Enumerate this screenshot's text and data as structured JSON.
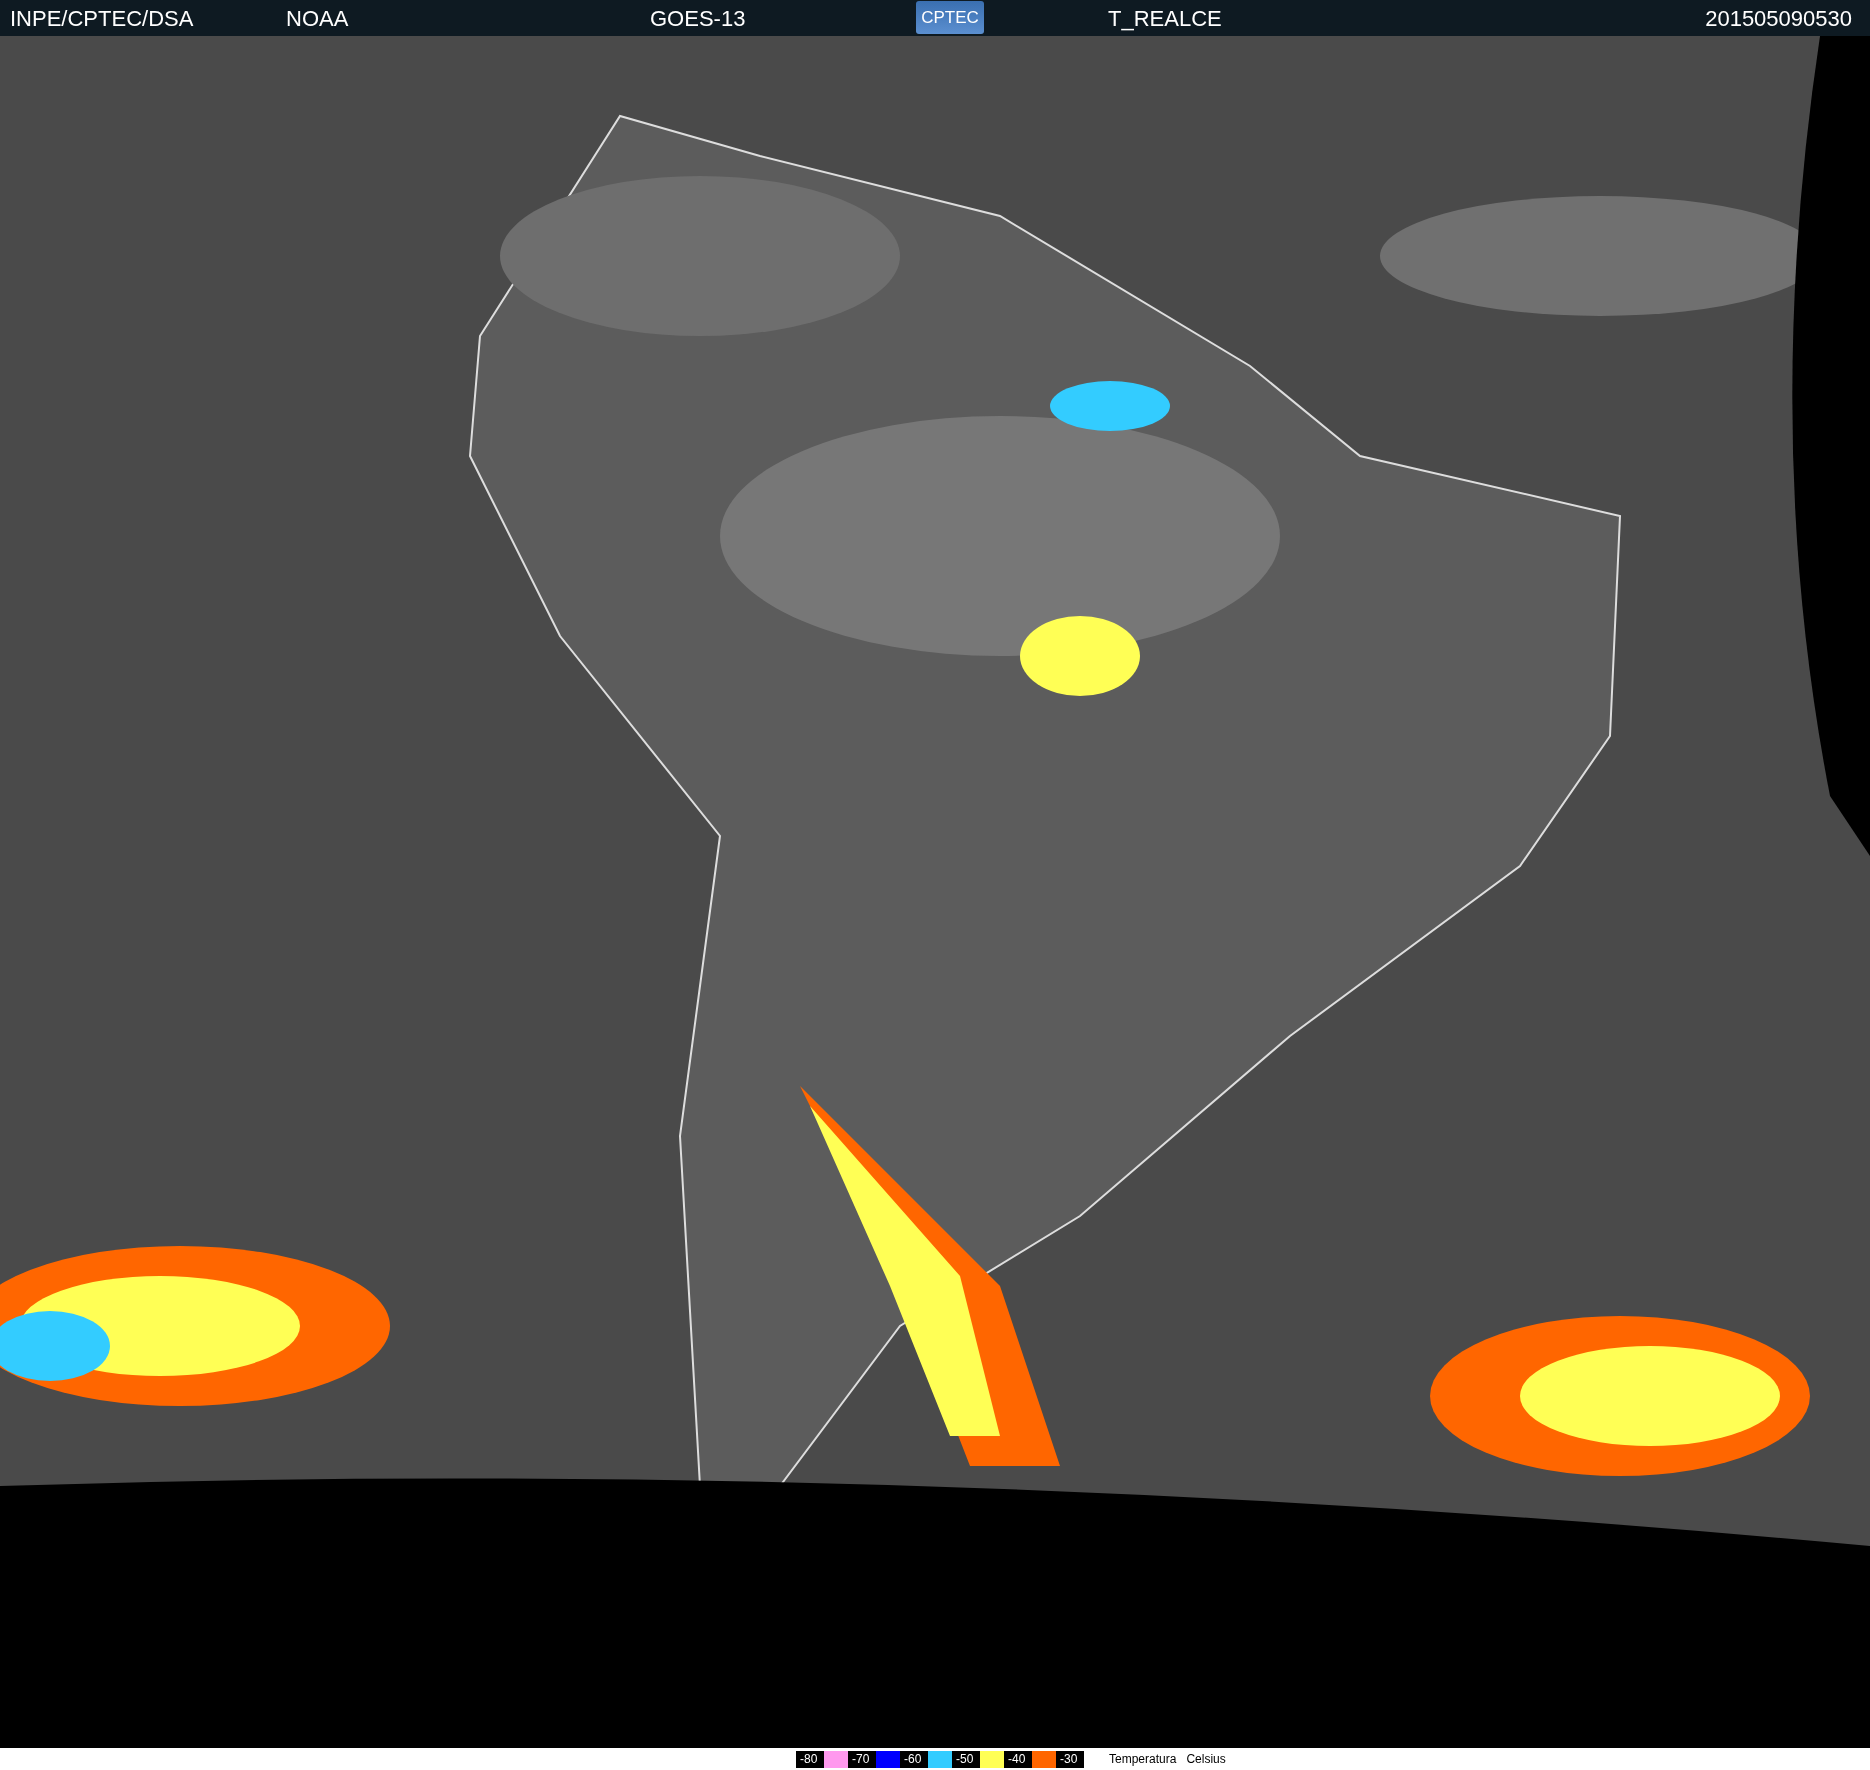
{
  "header": {
    "source": "INPE/CPTEC/DSA",
    "agency": "NOAA",
    "satellite": "GOES-13",
    "logo": "CPTEC",
    "product": "T_REALCE",
    "timestamp": "201505090530"
  },
  "legend": {
    "steps": [
      {
        "label": "-80",
        "color": "#ff99ee"
      },
      {
        "label": "-70",
        "color": "#0000ff"
      },
      {
        "label": "-60",
        "color": "#33ccff"
      },
      {
        "label": "-50",
        "color": "#ffff55"
      },
      {
        "label": "-40",
        "color": "#ff6600"
      },
      {
        "label": "-30"
      }
    ],
    "title": "Temperatura",
    "unit": "Celsius"
  }
}
